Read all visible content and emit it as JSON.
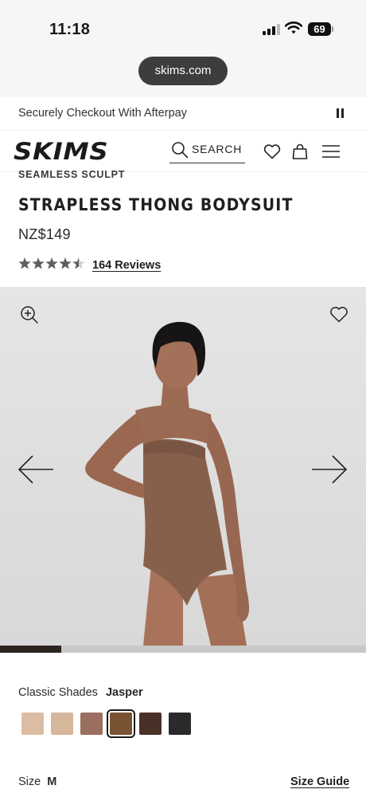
{
  "status_bar": {
    "time": "11:18",
    "battery": "69"
  },
  "browser": {
    "url": "skims.com"
  },
  "promo": {
    "text": "Securely Checkout With Afterpay"
  },
  "header": {
    "logo": "SKIMS",
    "search_label": "SEARCH"
  },
  "product": {
    "collection": "SEAMLESS SCULPT",
    "title": "STRAPLESS THONG BODYSUIT",
    "price": "NZ$149",
    "rating": 4.5,
    "reviews_label": "164 Reviews"
  },
  "gallery": {
    "progress": 0.167
  },
  "shades": {
    "label": "Classic Shades",
    "selected": "Jasper",
    "swatch_colors": [
      "#dcbda3",
      "#d6b79c",
      "#9b6f5f",
      "#7a5432",
      "#4a3128",
      "#2a2a2c"
    ],
    "selected_index": 3
  },
  "size": {
    "label": "Size",
    "value": "M",
    "guide_label": "Size Guide"
  },
  "icons": [
    "pause-icon",
    "search-icon",
    "heart-icon",
    "bag-icon",
    "menu-icon",
    "zoom-in-icon",
    "arrow-left-icon",
    "arrow-right-icon"
  ]
}
